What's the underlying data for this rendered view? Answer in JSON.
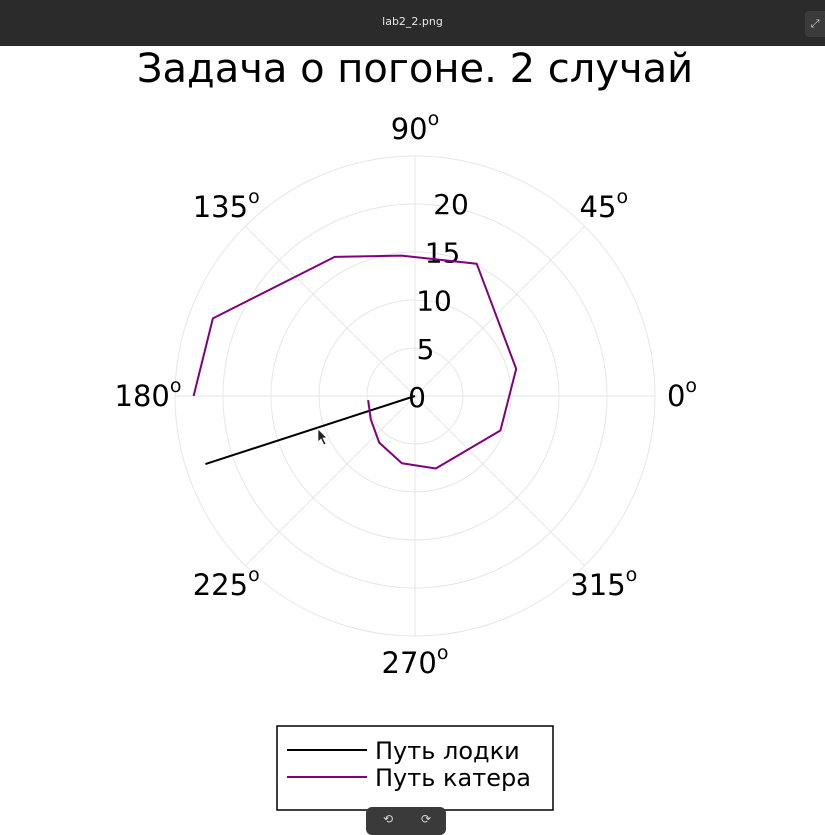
{
  "window": {
    "title": "lab2_2.png",
    "expand_icon": "expand-icon"
  },
  "toolbar": {
    "rotate_left_icon": "rotate-left-icon",
    "rotate_right_icon": "rotate-right-icon",
    "rotate_left_glyph": "⟲",
    "rotate_right_glyph": "⟳"
  },
  "chart_data": {
    "type": "polar-line",
    "title": "Задача о погоне. 2 случай",
    "angle_ticks": [
      {
        "deg": 0,
        "label": "0"
      },
      {
        "deg": 45,
        "label": "45"
      },
      {
        "deg": 90,
        "label": "90"
      },
      {
        "deg": 135,
        "label": "135"
      },
      {
        "deg": 180,
        "label": "180"
      },
      {
        "deg": 225,
        "label": "225"
      },
      {
        "deg": 270,
        "label": "270"
      },
      {
        "deg": 315,
        "label": "315"
      }
    ],
    "angle_unit_superscript": "o",
    "radial_ticks": [
      0,
      5,
      10,
      15,
      20
    ],
    "rlim": [
      0,
      24.5
    ],
    "grid": true,
    "legend_position": "bottom-center",
    "series": [
      {
        "name": "Путь лодки",
        "color": "#000000",
        "points": [
          {
            "theta_deg": 198,
            "r": 0
          },
          {
            "theta_deg": 198,
            "r": 22.5
          }
        ]
      },
      {
        "name": "Путь катера",
        "color": "#800080",
        "points": [
          {
            "theta_deg": 185.0,
            "r": 4.8
          },
          {
            "theta_deg": 207.5,
            "r": 5.1
          },
          {
            "theta_deg": 232.5,
            "r": 6.0
          },
          {
            "theta_deg": 259.0,
            "r": 7.0
          },
          {
            "theta_deg": 286.0,
            "r": 7.7
          },
          {
            "theta_deg": 338.0,
            "r": 9.4
          },
          {
            "theta_deg": 15.0,
            "r": 10.7
          },
          {
            "theta_deg": 65.0,
            "r": 14.9
          },
          {
            "theta_deg": 95.5,
            "r": 14.4
          },
          {
            "theta_deg": 120.0,
            "r": 16.4
          },
          {
            "theta_deg": 159.0,
            "r": 22.1
          },
          {
            "theta_deg": 180.0,
            "r": 22.6
          }
        ]
      }
    ]
  }
}
